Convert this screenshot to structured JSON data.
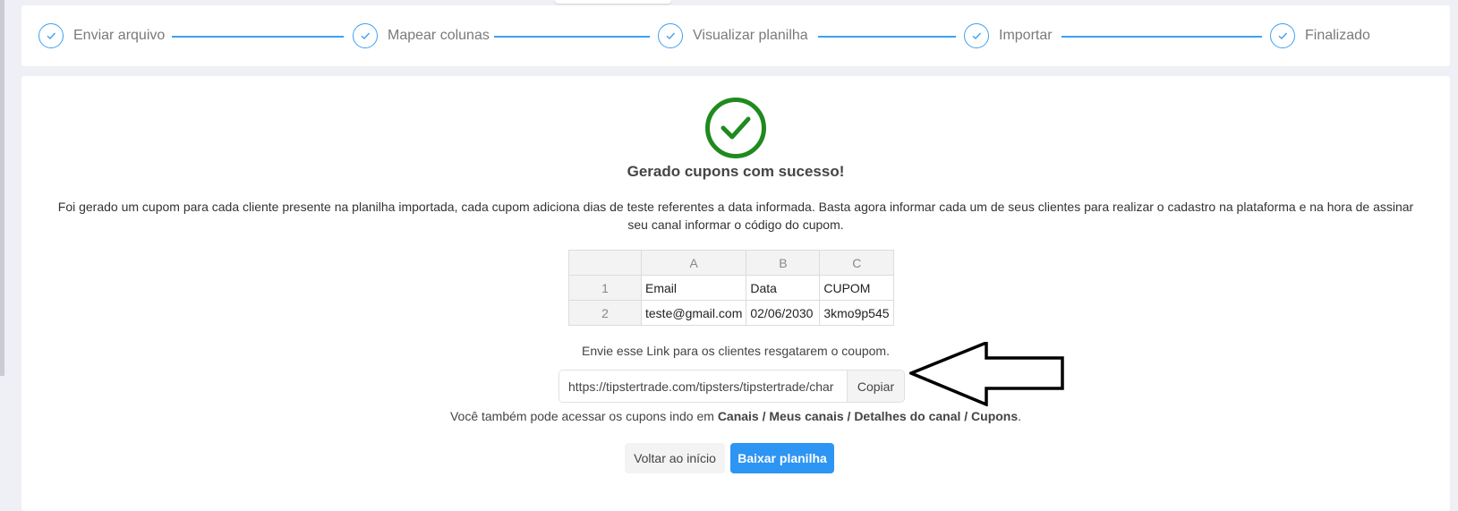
{
  "steps": [
    {
      "label": "Enviar arquivo"
    },
    {
      "label": "Mapear colunas"
    },
    {
      "label": "Visualizar planilha"
    },
    {
      "label": "Importar"
    },
    {
      "label": "Finalizado"
    }
  ],
  "result": {
    "title": "Gerado cupons com sucesso!",
    "description_line1": "Foi gerado um cupom para cada cliente presente na planilha importada, cada cupom adiciona dias de teste referentes a data informada. Basta agora informar cada um de seus clientes para realizar o cadastro na plataforma e na hora de assinar",
    "description_line2": "seu canal informar o código do cupom."
  },
  "sheet": {
    "columns": [
      "A",
      "B",
      "C"
    ],
    "rows": [
      {
        "num": "1",
        "cells": [
          "Email",
          "Data",
          "CUPOM"
        ]
      },
      {
        "num": "2",
        "cells": [
          "teste@gmail.com",
          "02/06/2030",
          "3kmo9p545"
        ]
      }
    ]
  },
  "link": {
    "caption": "Envie esse Link para os clientes resgatarem o coupom.",
    "value": "https://tipstertrade.com/tipsters/tipstertrade/char",
    "copy_label": "Copiar"
  },
  "also": {
    "prefix": "Você também pode acessar os cupons indo em ",
    "path": "Canais / Meus canais / Detalhes do canal / Cupons",
    "suffix": "."
  },
  "actions": {
    "back_label": "Voltar ao início",
    "download_label": "Baixar planilha"
  },
  "colors": {
    "accent": "#2d95f3",
    "success": "#1f8a1f"
  }
}
